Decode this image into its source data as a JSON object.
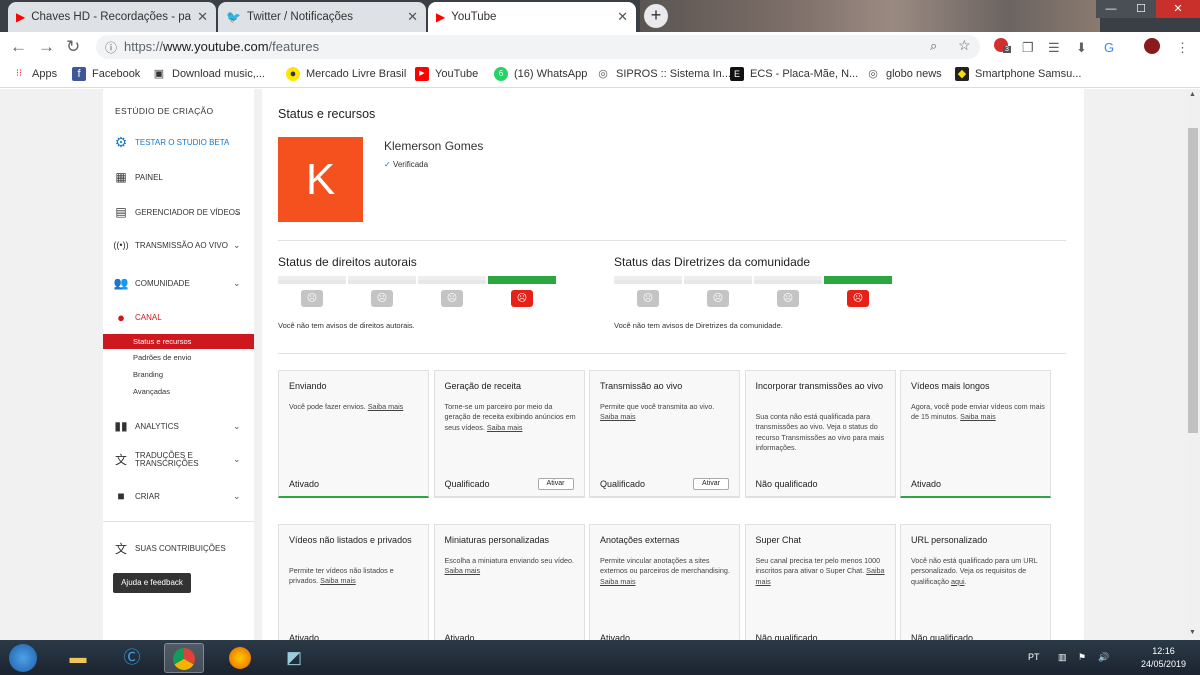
{
  "browser": {
    "tabs": [
      {
        "title": "Chaves HD - Recordações - parte",
        "close": "✕",
        "active": false
      },
      {
        "title": "Twitter / Notificações",
        "close": "✕",
        "active": false
      },
      {
        "title": "YouTube",
        "close": "✕",
        "active": true
      }
    ],
    "new_tab": "+",
    "window_buttons": [
      "—",
      "☐",
      "✕"
    ],
    "url_prefix": "https://",
    "url_host": "www.youtube.com",
    "url_path": "/features",
    "bookmarks": [
      {
        "label": "Apps",
        "icon": "apps-grid-icon"
      },
      {
        "label": "Facebook",
        "icon": "facebook-icon"
      },
      {
        "label": "Download music,...",
        "icon": "download-icon"
      },
      {
        "label": "Mercado Livre Brasil",
        "icon": "mercado-livre-icon"
      },
      {
        "label": "YouTube",
        "icon": "youtube-icon"
      },
      {
        "label": "(16) WhatsApp",
        "icon": "whatsapp-icon"
      },
      {
        "label": "SIPROS :: Sistema In...",
        "icon": "globe-icon"
      },
      {
        "label": "ECS - Placa-Mãe, N...",
        "icon": "ecs-icon"
      },
      {
        "label": "globo news",
        "icon": "globe-icon"
      },
      {
        "label": "Smartphone Samsu...",
        "icon": "smartphone-icon"
      }
    ],
    "extension_badge": "3"
  },
  "sidebar": {
    "title": "ESTÚDIO DE CRIAÇÃO",
    "beta": "TESTAR O STUDIO BETA",
    "items": [
      {
        "label": "PAINEL",
        "icon": "dashboard-icon"
      },
      {
        "label": "GERENCIADOR DE VÍDEOS",
        "icon": "video-manager-icon"
      },
      {
        "label": "TRANSMISSÃO AO VIVO",
        "icon": "live-broadcast-icon"
      },
      {
        "label": "COMUNIDADE",
        "icon": "community-icon"
      },
      {
        "label": "CANAL",
        "icon": "channel-icon"
      },
      {
        "label": "ANALYTICS",
        "icon": "analytics-icon"
      },
      {
        "label": "TRADUÇÕES E TRANSCRIÇÕES",
        "icon": "translate-icon"
      },
      {
        "label": "CRIAR",
        "icon": "create-video-icon"
      },
      {
        "label": "SUAS CONTRIBUIÇÕES",
        "icon": "contributions-icon"
      }
    ],
    "canal_subitems": [
      "Status e recursos",
      "Padrões de envio",
      "Branding",
      "Avançadas"
    ],
    "help_button": "Ajuda e feedback"
  },
  "page": {
    "title": "Status e recursos",
    "avatar_letter": "K",
    "channel_name": "Klemerson Gomes",
    "verified": "Verificada",
    "copyright": {
      "title": "Status de direitos autorais",
      "note": "Você não tem avisos de direitos autorais.",
      "strikes": 0
    },
    "community": {
      "title": "Status das Diretrizes da comunidade",
      "note": "Você não tem avisos de Diretrizes da comunidade.",
      "strikes": 0
    },
    "good_color": "#2ba640",
    "accent_red": "#cc181e"
  },
  "features": [
    {
      "title": "Enviando",
      "desc": "Você pode fazer envios.",
      "link": "Saiba mais",
      "status": "Ativado",
      "enabled": true,
      "button": ""
    },
    {
      "title": "Geração de receita",
      "desc": "Torne-se um parceiro por meio da geração de receita exibindo anúncios em seus vídeos.",
      "link": "Saiba mais",
      "status": "Qualificado",
      "enabled": false,
      "button": "Ativar"
    },
    {
      "title": "Transmissão ao vivo",
      "desc": "Permite que você transmita ao vivo.",
      "link": "Saiba mais",
      "status": "Qualificado",
      "enabled": false,
      "button": "Ativar"
    },
    {
      "title": "Incorporar transmissões ao vivo",
      "desc": "Sua conta não está qualificada para transmissões ao vivo. Veja o status do recurso Transmissões ao vivo para mais informações.",
      "link": "",
      "status": "Não qualificado",
      "enabled": false,
      "button": ""
    },
    {
      "title": "Vídeos mais longos",
      "desc": "Agora, você pode enviar vídeos com mais de 15 minutos.",
      "link": "Saiba mais",
      "status": "Ativado",
      "enabled": true,
      "button": ""
    },
    {
      "title": "Vídeos não listados e privados",
      "desc": "Permite ter vídeos não listados e privados.",
      "link": "Saiba mais",
      "status": "Ativado",
      "enabled": true,
      "button": ""
    },
    {
      "title": "Miniaturas personalizadas",
      "desc": "Escolha a miniatura enviando seu vídeo.",
      "link": "Saiba mais",
      "status": "Ativado",
      "enabled": true,
      "button": ""
    },
    {
      "title": "Anotações externas",
      "desc": "Permite vincular anotações a sites externos ou parceiros de merchandising.",
      "link": "Saiba mais",
      "status": "Ativado",
      "enabled": true,
      "button": ""
    },
    {
      "title": "Super Chat",
      "desc": "Seu canal precisa ter pelo menos 1000 inscritos para ativar o Super Chat.",
      "link": "Saiba mais",
      "status": "Não qualificado",
      "enabled": false,
      "button": ""
    },
    {
      "title": "URL personalizado",
      "desc": "Você não está qualificado para um URL personalizado. Veja os requisitos de qualificação",
      "link": "aqui",
      "status": "Não qualificado",
      "enabled": false,
      "button": ""
    }
  ],
  "taskbar": {
    "lang": "PT",
    "time": "12:16",
    "date": "24/05/2019"
  }
}
